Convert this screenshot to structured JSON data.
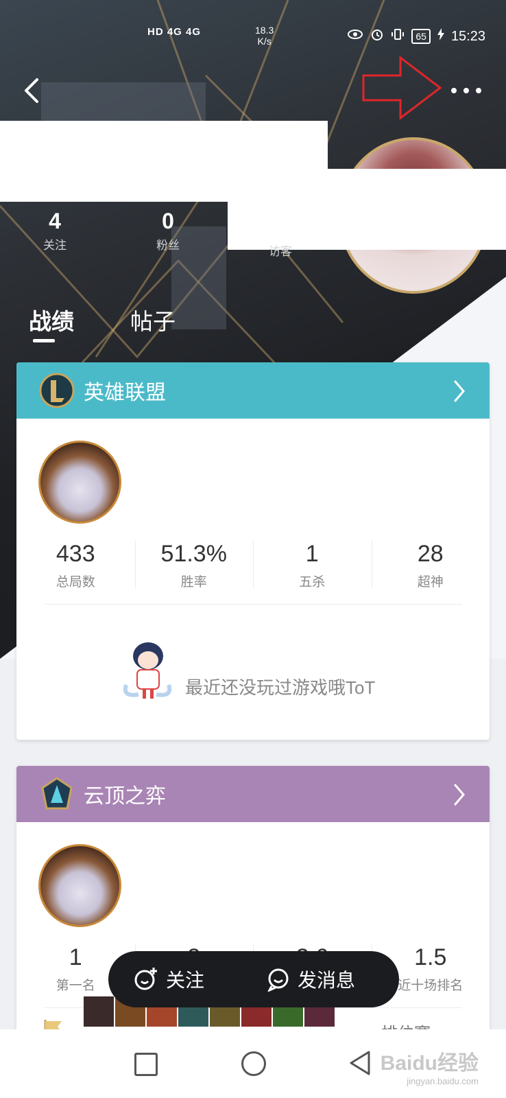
{
  "status": {
    "left_icons": "HD 4G 4G",
    "speed": "18.3",
    "speed_unit": "K/s",
    "battery": "65",
    "time": "15:23"
  },
  "profile": {
    "stats": [
      {
        "num": "4",
        "label": "关注"
      },
      {
        "num": "0",
        "label": "粉丝"
      }
    ],
    "visitor_label": "访客"
  },
  "tabs": [
    "战绩",
    "帖子"
  ],
  "lol_card": {
    "title": "英雄联盟",
    "header_color": "#4bbac8",
    "stats": [
      {
        "value": "433",
        "label": "总局数"
      },
      {
        "value": "51.3%",
        "label": "胜率"
      },
      {
        "value": "1",
        "label": "五杀"
      },
      {
        "value": "28",
        "label": "超神"
      }
    ],
    "empty_message": "最近还没玩过游戏哦ToT"
  },
  "tft_card": {
    "title": "云顶之弈",
    "header_color": "#a985b5",
    "stats": [
      {
        "value": "1",
        "label": "第一名"
      },
      {
        "value": "2",
        "label": ""
      },
      {
        "value": "2.6",
        "label": ""
      },
      {
        "value": "1.5",
        "label": "近十场排名"
      }
    ],
    "rank_text": "排位赛"
  },
  "floating_bar": {
    "follow": "关注",
    "message": "发消息"
  },
  "watermark": {
    "brand": "Baidu经验",
    "site": "jingyan.baidu.com"
  }
}
